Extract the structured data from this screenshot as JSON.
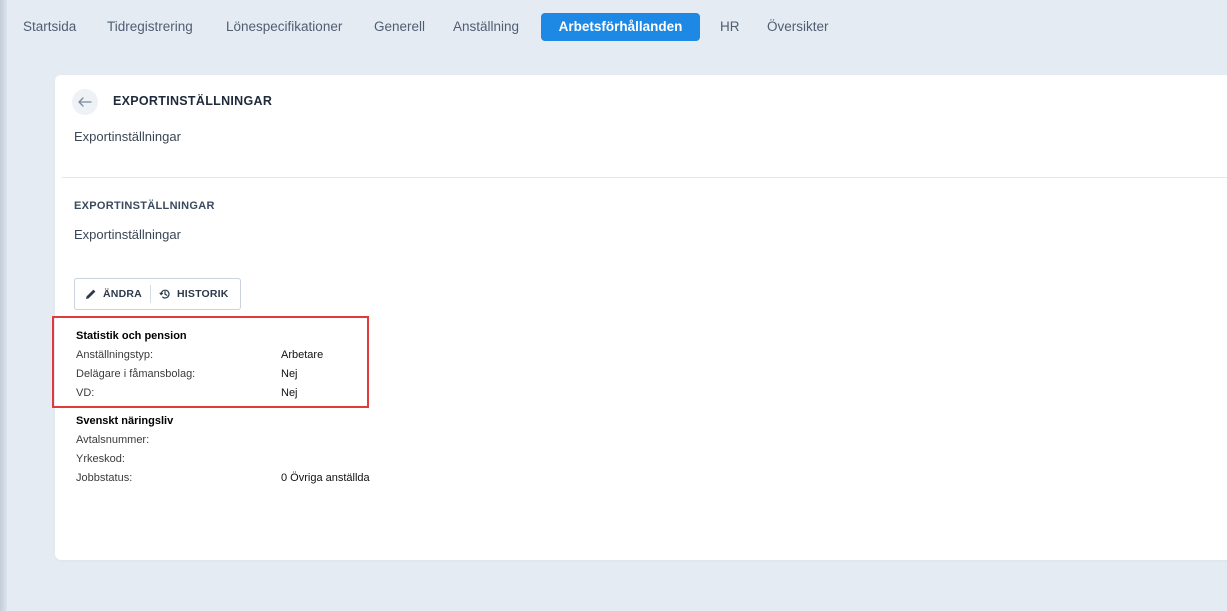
{
  "nav": {
    "tabs": [
      {
        "label": "Startsida"
      },
      {
        "label": "Tidregistrering"
      },
      {
        "label": "Lönespecifikationer"
      },
      {
        "label": "Generell"
      },
      {
        "label": "Anställning"
      },
      {
        "label": "Arbetsförhållanden",
        "active": true
      },
      {
        "label": "HR"
      },
      {
        "label": "Översikter"
      }
    ]
  },
  "card": {
    "title": "EXPORTINSTÄLLNINGAR",
    "subtitle": "Exportinställningar",
    "section": {
      "title": "EXPORTINSTÄLLNINGAR",
      "subtitle": "Exportinställningar"
    },
    "buttons": {
      "edit_label": "ÄNDRA",
      "history_label": "HISTORIK"
    },
    "groups": [
      {
        "heading": "Statistik och pension",
        "rows": [
          {
            "label": "Anställningstyp:",
            "value": "Arbetare"
          },
          {
            "label": "Delägare i fåmansbolag:",
            "value": "Nej"
          },
          {
            "label": "VD:",
            "value": "Nej"
          }
        ]
      },
      {
        "heading": "Svenskt näringsliv",
        "rows": [
          {
            "label": "Avtalsnummer:",
            "value": ""
          },
          {
            "label": "Yrkeskod:",
            "value": ""
          },
          {
            "label": "Jobbstatus:",
            "value": "0 Övriga anställda"
          }
        ]
      }
    ]
  },
  "colors": {
    "accent": "#1e88e5",
    "background": "#e5ebf3",
    "highlight": "#e03a3a"
  },
  "icons": {
    "back": "arrow-left-icon",
    "edit": "pencil-icon",
    "history": "history-icon"
  }
}
